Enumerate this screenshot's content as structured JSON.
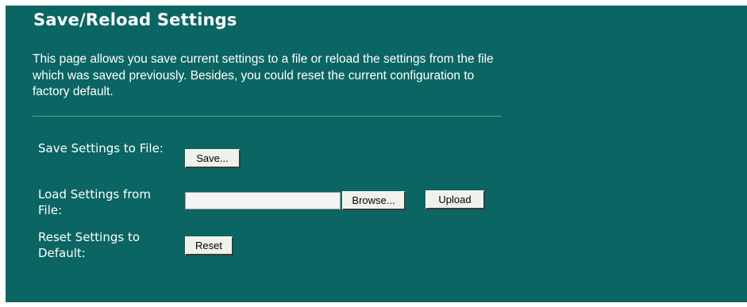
{
  "page": {
    "title": "Save/Reload Settings",
    "description": "This page allows you save current settings to a file or reload the settings from the file which was saved previously. Besides, you could reset the current configuration to factory default."
  },
  "rows": {
    "save": {
      "label": "Save Settings to File:",
      "button": "Save..."
    },
    "load": {
      "label": "Load Settings from File:",
      "file_value": "",
      "browse_button": "Browse...",
      "upload_button": "Upload"
    },
    "reset": {
      "label": "Reset Settings to Default:",
      "button": "Reset"
    }
  },
  "colors": {
    "panel_background": "#0b6562",
    "text": "#ffffff",
    "button_face": "#f1f1ec"
  }
}
